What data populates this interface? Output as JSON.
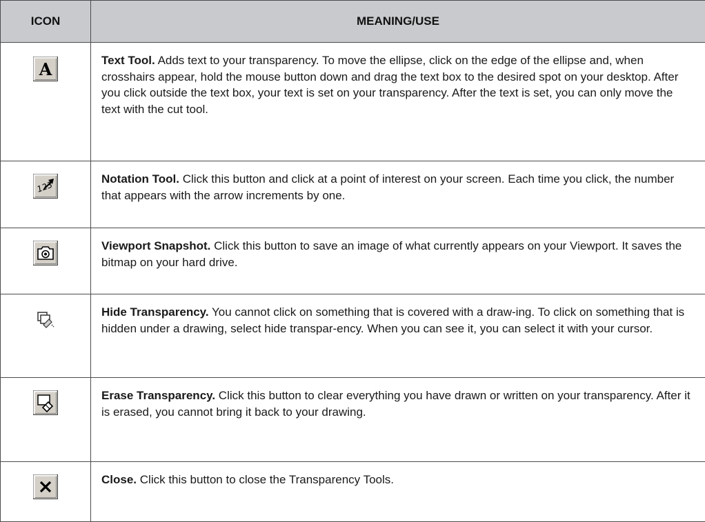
{
  "header": {
    "icon": "ICON",
    "meaning": "MEANING/USE"
  },
  "rows": [
    {
      "icon": "text-tool-icon",
      "title": "Text Tool.",
      "description": "Adds text to your transparency. To move the ellipse, click on the edge of the ellipse and, when crosshairs appear, hold the mouse button down and drag the text box to the desired spot on your desktop. After you click outside the text box, your text is set on your transparency. After the text is set, you can only move the text with the cut tool.",
      "glyph": "A"
    },
    {
      "icon": "notation-tool-icon",
      "title": "Notation Tool.",
      "description": "Click this button and click at a point of interest on your screen. Each time you click, the number that appears with the arrow increments by one.",
      "glyph": "123"
    },
    {
      "icon": "camera-icon",
      "title": "Viewport Snapshot.",
      "description": "Click this button to save an image of what currently appears on your Viewport. It saves the bitmap on your hard drive."
    },
    {
      "icon": "hide-transparency-icon",
      "title": "Hide Transparency.",
      "description": "You cannot click on something that is covered with a draw-ing. To click on something that is hidden under a drawing, select hide transpar-ency. When you can see it, you can select it with your cursor."
    },
    {
      "icon": "eraser-icon",
      "title": "Erase Transparency.",
      "description": "Click this button to clear everything you have drawn or written on your transparency. After it is erased, you cannot bring it back to your drawing."
    },
    {
      "icon": "close-icon",
      "title": "Close.",
      "description": "Click this button to close the Transparency Tools."
    }
  ],
  "colors": {
    "header_bg": "#c8cacd",
    "border": "#4a4a4a",
    "button_face": "#d4d0c8"
  }
}
